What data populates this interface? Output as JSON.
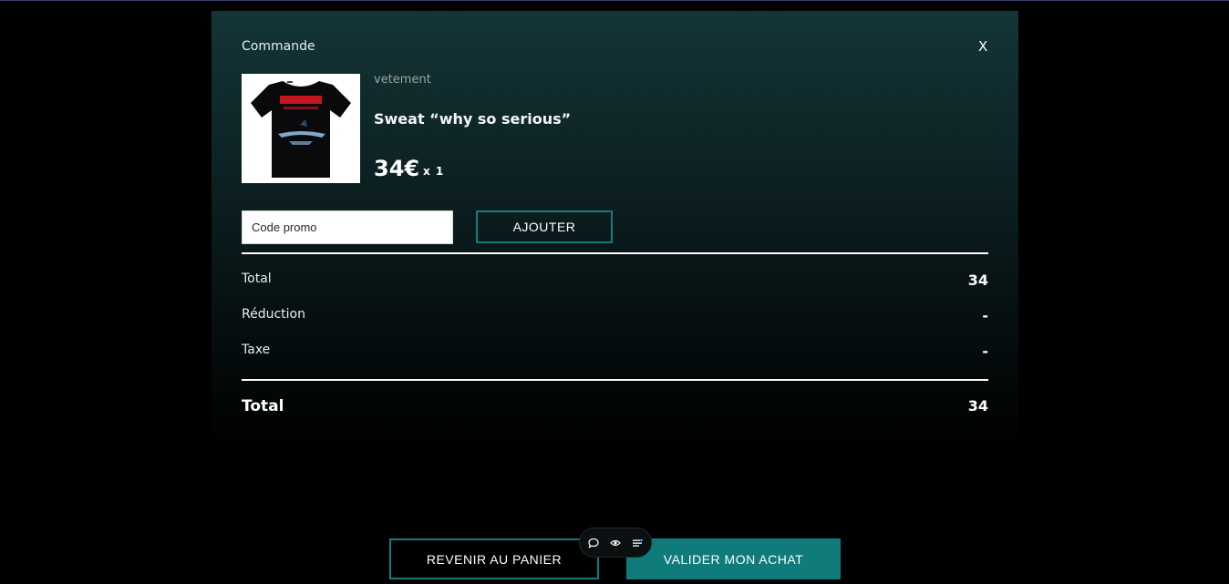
{
  "modal": {
    "title": "Commande",
    "close_label": "X"
  },
  "product": {
    "category": "vetement",
    "name": "Sweat “why so serious”",
    "price": "34€",
    "quantity": "x 1",
    "image_icon": "batman-tshirt-image"
  },
  "promo": {
    "placeholder": "Code promo",
    "value": "",
    "add_label": "AJOUTER"
  },
  "summary": {
    "rows": [
      {
        "label": "Total",
        "value": "34"
      },
      {
        "label": "Réduction",
        "value": "-"
      },
      {
        "label": "Taxe",
        "value": "-"
      }
    ],
    "final": {
      "label": "Total",
      "value": "34"
    }
  },
  "footer": {
    "back_label": "REVENIR AU PANIER",
    "validate_label": "VALIDER MON ACHAT"
  },
  "toolbar": {
    "icons": [
      "comment-icon",
      "eye-icon",
      "list-icon"
    ]
  },
  "colors": {
    "accent": "#0f7b7b",
    "accent_border": "#147c7c",
    "modal_top": "#143536",
    "background": "#000000"
  }
}
